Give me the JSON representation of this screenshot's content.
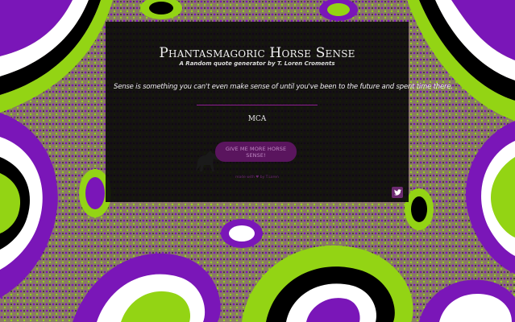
{
  "app": {
    "title": "Phantasmagoric Horse Sense",
    "subtitle": "A Random quote generator by T. Loren Croments"
  },
  "quote": {
    "text": "Sense is something you can't even make sense of until you've been to the future and spent time there.",
    "author": "MCA"
  },
  "actions": {
    "new_quote_label": "Give me more horse sense!",
    "credit_text": "made with ♥ by T.Loren",
    "tweet_icon": "twitter-icon"
  },
  "colors": {
    "accent": "#8e1f8f",
    "button_bg": "#5a155e",
    "card_bg": "#080808",
    "bg_purple": "#7a16b8",
    "bg_green": "#93d414",
    "bg_tan": "#8a7a66"
  }
}
